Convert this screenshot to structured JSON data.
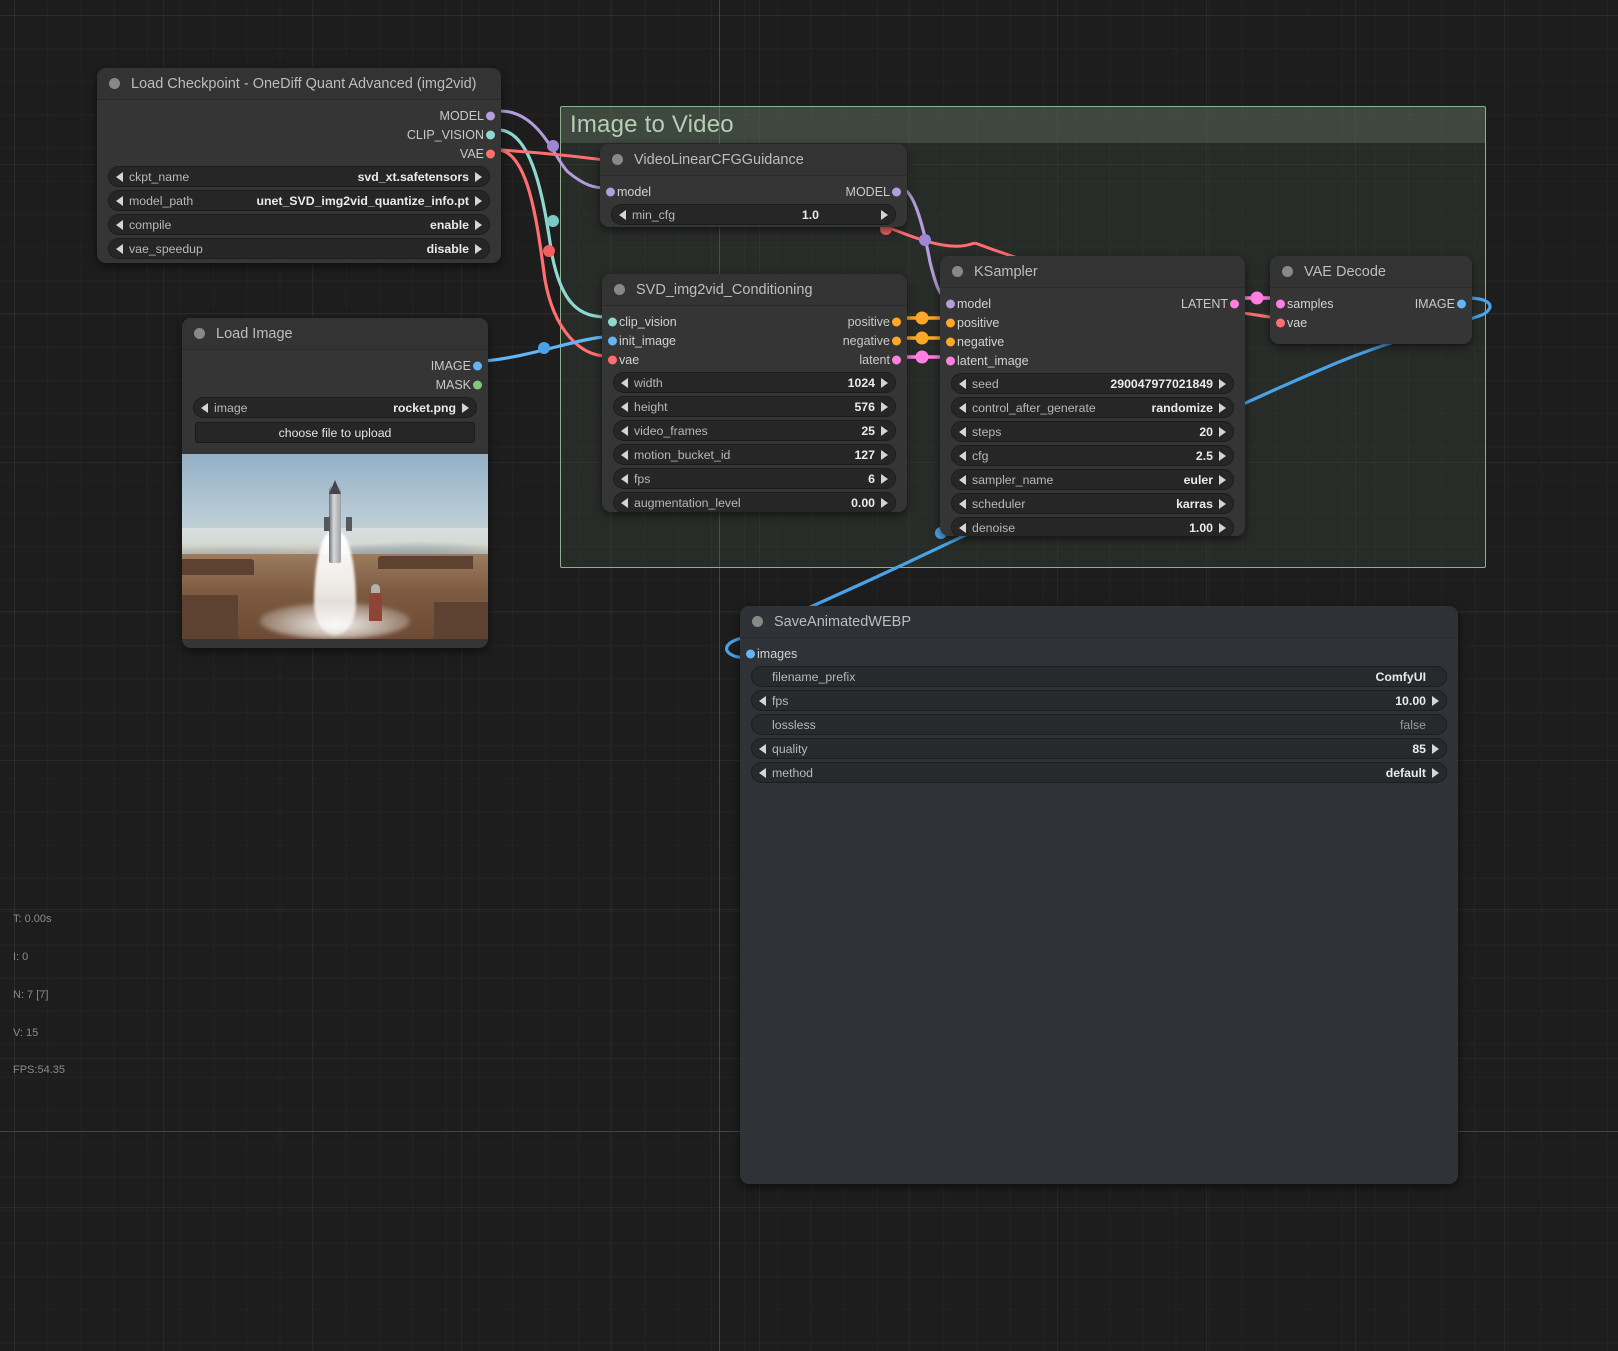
{
  "app": {
    "canvas_name": "comfyui-node-graph"
  },
  "group": {
    "title": "Image to Video",
    "color": "#8fae8f"
  },
  "stats": {
    "time": "T: 0.00s",
    "iterations": "I: 0",
    "nodes": "N: 7 [7]",
    "vertices": "V: 15",
    "fps": "FPS:54.35"
  },
  "port_colors": {
    "MODEL": "#b39ddb",
    "CLIP_VISION": "#8fd8d0",
    "VAE": "#ff6f6f",
    "IMAGE": "#64b5f6",
    "MASK": "#81c784",
    "CONDITIONING": "#ffa726",
    "LATENT": "#ff80e0"
  },
  "nodes": {
    "load_checkpoint": {
      "title": "Load Checkpoint - OneDiff Quant Advanced (img2vid)",
      "outputs": [
        {
          "label": "MODEL",
          "type": "MODEL"
        },
        {
          "label": "CLIP_VISION",
          "type": "CLIP_VISION"
        },
        {
          "label": "VAE",
          "type": "VAE"
        }
      ],
      "widgets": [
        {
          "name": "ckpt_name",
          "value": "svd_xt.safetensors",
          "stepper": true
        },
        {
          "name": "model_path",
          "value": "unet_SVD_img2vid_quantize_info.pt",
          "stepper": true
        },
        {
          "name": "compile",
          "value": "enable",
          "stepper": true
        },
        {
          "name": "vae_speedup",
          "value": "disable",
          "stepper": true
        }
      ]
    },
    "load_image": {
      "title": "Load Image",
      "outputs": [
        {
          "label": "IMAGE",
          "type": "IMAGE"
        },
        {
          "label": "MASK",
          "type": "MASK"
        }
      ],
      "widgets": [
        {
          "name": "image",
          "value": "rocket.png",
          "stepper": true
        }
      ],
      "upload_button": "choose file to upload",
      "preview_alt": "rocket launching over desert"
    },
    "video_linear_cfg": {
      "title": "VideoLinearCFGGuidance",
      "inputs": [
        {
          "label": "model",
          "type": "MODEL"
        }
      ],
      "outputs": [
        {
          "label": "MODEL",
          "type": "MODEL"
        }
      ],
      "widgets": [
        {
          "name": "min_cfg",
          "value": "1.0",
          "stepper": true
        }
      ]
    },
    "svd_conditioning": {
      "title": "SVD_img2vid_Conditioning",
      "inputs": [
        {
          "label": "clip_vision",
          "type": "CLIP_VISION"
        },
        {
          "label": "init_image",
          "type": "IMAGE"
        },
        {
          "label": "vae",
          "type": "VAE"
        }
      ],
      "outputs": [
        {
          "label": "positive",
          "type": "CONDITIONING"
        },
        {
          "label": "negative",
          "type": "CONDITIONING"
        },
        {
          "label": "latent",
          "type": "LATENT"
        }
      ],
      "widgets": [
        {
          "name": "width",
          "value": "1024",
          "stepper": true
        },
        {
          "name": "height",
          "value": "576",
          "stepper": true
        },
        {
          "name": "video_frames",
          "value": "25",
          "stepper": true
        },
        {
          "name": "motion_bucket_id",
          "value": "127",
          "stepper": true
        },
        {
          "name": "fps",
          "value": "6",
          "stepper": true
        },
        {
          "name": "augmentation_level",
          "value": "0.00",
          "stepper": true
        }
      ]
    },
    "ksampler": {
      "title": "KSampler",
      "inputs": [
        {
          "label": "model",
          "type": "MODEL"
        },
        {
          "label": "positive",
          "type": "CONDITIONING"
        },
        {
          "label": "negative",
          "type": "CONDITIONING"
        },
        {
          "label": "latent_image",
          "type": "LATENT"
        }
      ],
      "outputs": [
        {
          "label": "LATENT",
          "type": "LATENT"
        }
      ],
      "widgets": [
        {
          "name": "seed",
          "value": "290047977021849",
          "stepper": true
        },
        {
          "name": "control_after_generate",
          "value": "randomize",
          "stepper": true
        },
        {
          "name": "steps",
          "value": "20",
          "stepper": true
        },
        {
          "name": "cfg",
          "value": "2.5",
          "stepper": true
        },
        {
          "name": "sampler_name",
          "value": "euler",
          "stepper": true
        },
        {
          "name": "scheduler",
          "value": "karras",
          "stepper": true
        },
        {
          "name": "denoise",
          "value": "1.00",
          "stepper": true
        }
      ]
    },
    "vae_decode": {
      "title": "VAE Decode",
      "inputs": [
        {
          "label": "samples",
          "type": "LATENT"
        },
        {
          "label": "vae",
          "type": "VAE"
        }
      ],
      "outputs": [
        {
          "label": "IMAGE",
          "type": "IMAGE"
        }
      ]
    },
    "save_webp": {
      "title": "SaveAnimatedWEBP",
      "inputs": [
        {
          "label": "images",
          "type": "IMAGE"
        }
      ],
      "widgets": [
        {
          "name": "filename_prefix",
          "value": "ComfyUI",
          "stepper": false
        },
        {
          "name": "fps",
          "value": "10.00",
          "stepper": true
        },
        {
          "name": "lossless",
          "value": "false",
          "stepper": false,
          "dim": true
        },
        {
          "name": "quality",
          "value": "85",
          "stepper": true
        },
        {
          "name": "method",
          "value": "default",
          "stepper": true
        }
      ]
    }
  }
}
